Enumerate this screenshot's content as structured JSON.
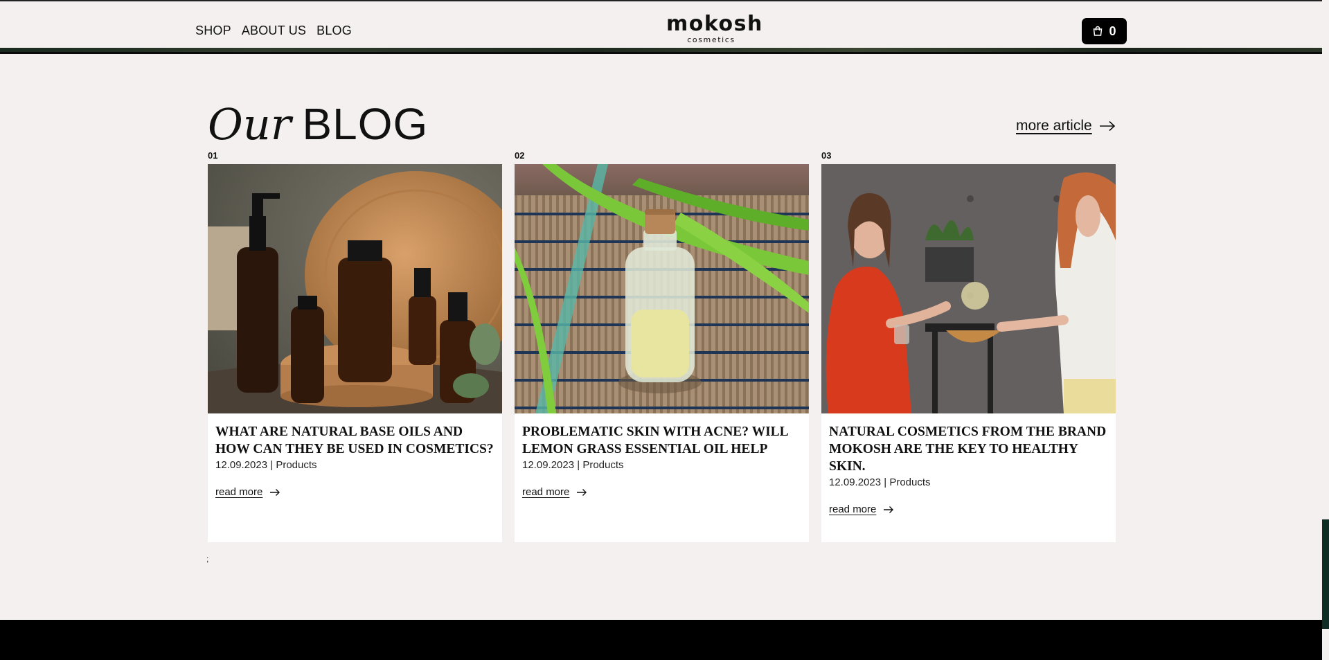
{
  "header": {
    "nav": [
      "SHOP",
      "ABOUT US",
      "BLOG"
    ],
    "logo_main": "mokosh",
    "logo_sub": "cosmetics",
    "cart_count": "0",
    "cart_icon": "shopping-bag-icon"
  },
  "blog": {
    "title_italic": "Our",
    "title_main": "BLOG",
    "more_article": "more article",
    "trailing_text": ";",
    "posts": [
      {
        "number": "01",
        "title": "WHAT ARE NATURAL BASE OILS AND HOW CAN THEY BE USED IN COSMETICS?",
        "date": "12.09.2023",
        "category": "Products",
        "read_more": "read more"
      },
      {
        "number": "02",
        "title": "PROBLEMATIC SKIN WITH ACNE? WILL LEMON GRASS ESSENTIAL OIL HELP",
        "date": "12.09.2023",
        "category": "Products",
        "read_more": "read more"
      },
      {
        "number": "03",
        "title": "NATURAL COSMETICS FROM THE BRAND MOKOSH ARE THE KEY TO HEALTHY SKIN.",
        "date": "12.09.2023",
        "category": "Products",
        "read_more": "read more"
      }
    ]
  },
  "colors": {
    "background": "#f3f0ef",
    "accent_dark": "#000000",
    "scroll_thumb": "#0f2d25"
  }
}
